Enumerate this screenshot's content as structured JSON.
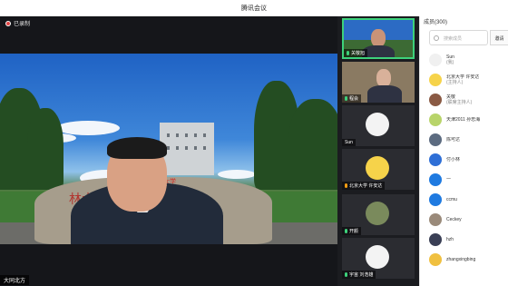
{
  "window": {
    "title": "腾讯会议"
  },
  "recording": {
    "label": "已录制"
  },
  "main_video": {
    "speaker_label": "大同北方",
    "rock_banner": "北京林业大学",
    "rock_inscription": "林大学"
  },
  "gallery": {
    "tiles": [
      {
        "label": "关敬旭",
        "active": true
      },
      {
        "label": "程会",
        "active": false
      },
      {
        "label": "Sun",
        "active": false
      },
      {
        "label": "北京大学 许安达",
        "active": false
      },
      {
        "label": "开颜",
        "active": false
      },
      {
        "label": "宇宙 刘浩雄",
        "active": false
      }
    ]
  },
  "participants": {
    "header": "成员(300)",
    "search_placeholder": "搜索成员",
    "side_button": "邀请",
    "members": [
      {
        "name": "Sun",
        "sub": "(我)",
        "color": "#f0f0f0"
      },
      {
        "name": "北京大学 许安达",
        "sub": "(主持人)",
        "color": "#f6d34a"
      },
      {
        "name": "关敬",
        "sub": "(联席主持人)",
        "color": "#8a5a44"
      },
      {
        "name": "天津2011 孙忠海",
        "sub": "",
        "color": "#b8d46a"
      },
      {
        "name": "陈可达",
        "sub": "",
        "color": "#5c6b80"
      },
      {
        "name": "付小林",
        "sub": "",
        "color": "#2f6fd6"
      },
      {
        "name": "一",
        "sub": "",
        "color": "#1f7ae0"
      },
      {
        "name": "ccmu",
        "sub": "",
        "color": "#1f7ae0"
      },
      {
        "name": "Ceckey",
        "sub": "",
        "color": "#9a8a7a"
      },
      {
        "name": "hzh",
        "sub": "",
        "color": "#3a3f55"
      },
      {
        "name": "zhangxingbing",
        "sub": "",
        "color": "#f0c040"
      }
    ]
  }
}
